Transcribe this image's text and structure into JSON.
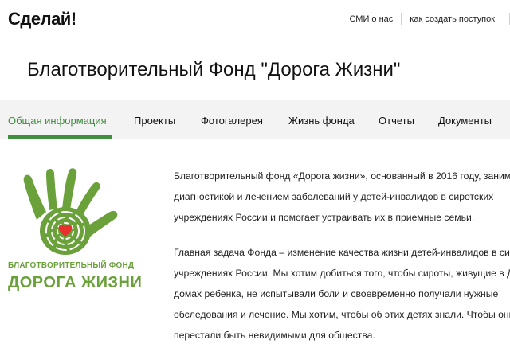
{
  "header": {
    "logo": "Сделай!",
    "links": [
      {
        "label": "СМИ о нас"
      },
      {
        "label": "как создать поступок"
      }
    ]
  },
  "page": {
    "title": "Благотворительный Фонд \"Дорога Жизни\""
  },
  "tabs": [
    {
      "label": "Общая информация",
      "active": true
    },
    {
      "label": "Проекты",
      "active": false
    },
    {
      "label": "Фотогалерея",
      "active": false
    },
    {
      "label": "Жизнь фонда",
      "active": false
    },
    {
      "label": "Отчеты",
      "active": false
    },
    {
      "label": "Документы",
      "active": false
    }
  ],
  "logo_card": {
    "line1": "БЛАГОТВОРИТЕЛЬНЫЙ ФОНД",
    "line2": "ДОРОГА ЖИЗНИ",
    "icons": [
      "hand-icon",
      "heart-icon"
    ],
    "colors": {
      "green": "#6aa13a",
      "heart": "#e8312f"
    }
  },
  "content": {
    "paragraph1": [
      "Благотворительный фонд «Дорога жизни», основанный в 2016 году, занима",
      "диагностикой и лечением заболеваний у детей-инвалидов в сиротских",
      "учреждениях России и помогает устраивать их в приемные семьи."
    ],
    "paragraph2": [
      "Главная задача Фонда – изменение качества жизни детей-инвалидов в сиро",
      "учреждениях России. Мы хотим добиться того, чтобы сироты, живущие в Д",
      "домах ребенка, не испытывали боли и своевременно получали нужные",
      "обследования и лечение. Мы хотим, чтобы об этих детях знали. Чтобы они",
      "перестали быть невидимыми для общества."
    ]
  },
  "colors": {
    "accent": "#3e8f3e",
    "tabs_bg": "#f3f3f3"
  }
}
